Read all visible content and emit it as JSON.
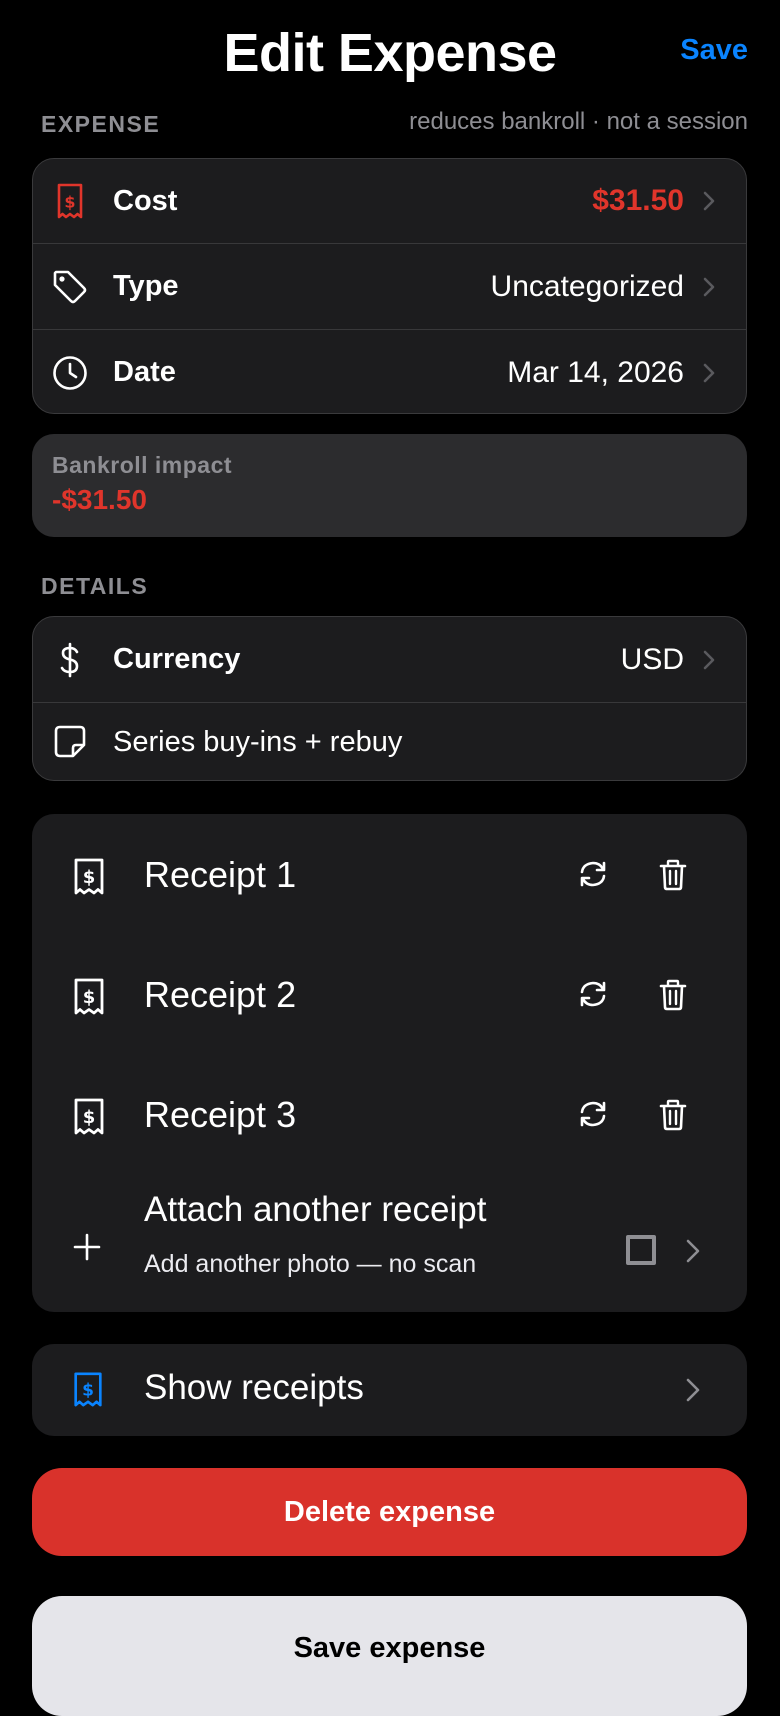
{
  "header": {
    "title": "Edit Expense",
    "save_label": "Save"
  },
  "expense_section": {
    "label": "EXPENSE",
    "note": "reduces bankroll · not a session",
    "rows": [
      {
        "icon": "receipt-icon",
        "label": "Cost",
        "value": "$31.50"
      },
      {
        "icon": "tag-icon",
        "label": "Type",
        "value": "Uncategorized"
      },
      {
        "icon": "clock-icon",
        "label": "Date",
        "value": "Mar 14, 2026"
      }
    ]
  },
  "bankroll_impact": {
    "label": "Bankroll impact",
    "value": "-$31.50"
  },
  "details_section": {
    "label": "DETAILS",
    "currency_label": "Currency",
    "currency_value": "USD",
    "note_text": "Series buy-ins + rebuy"
  },
  "receipts": {
    "items": [
      {
        "label": "Receipt 1"
      },
      {
        "label": "Receipt 2"
      },
      {
        "label": "Receipt 3"
      }
    ],
    "attach_title": "Attach another receipt",
    "attach_subtitle": "Add another photo — no scan"
  },
  "show_receipts_label": "Show receipts",
  "buttons": {
    "delete_label": "Delete expense",
    "save_label": "Save expense"
  },
  "colors": {
    "accent": "#0a84ff",
    "negative": "#e0352b",
    "danger_button": "#d9322b"
  }
}
